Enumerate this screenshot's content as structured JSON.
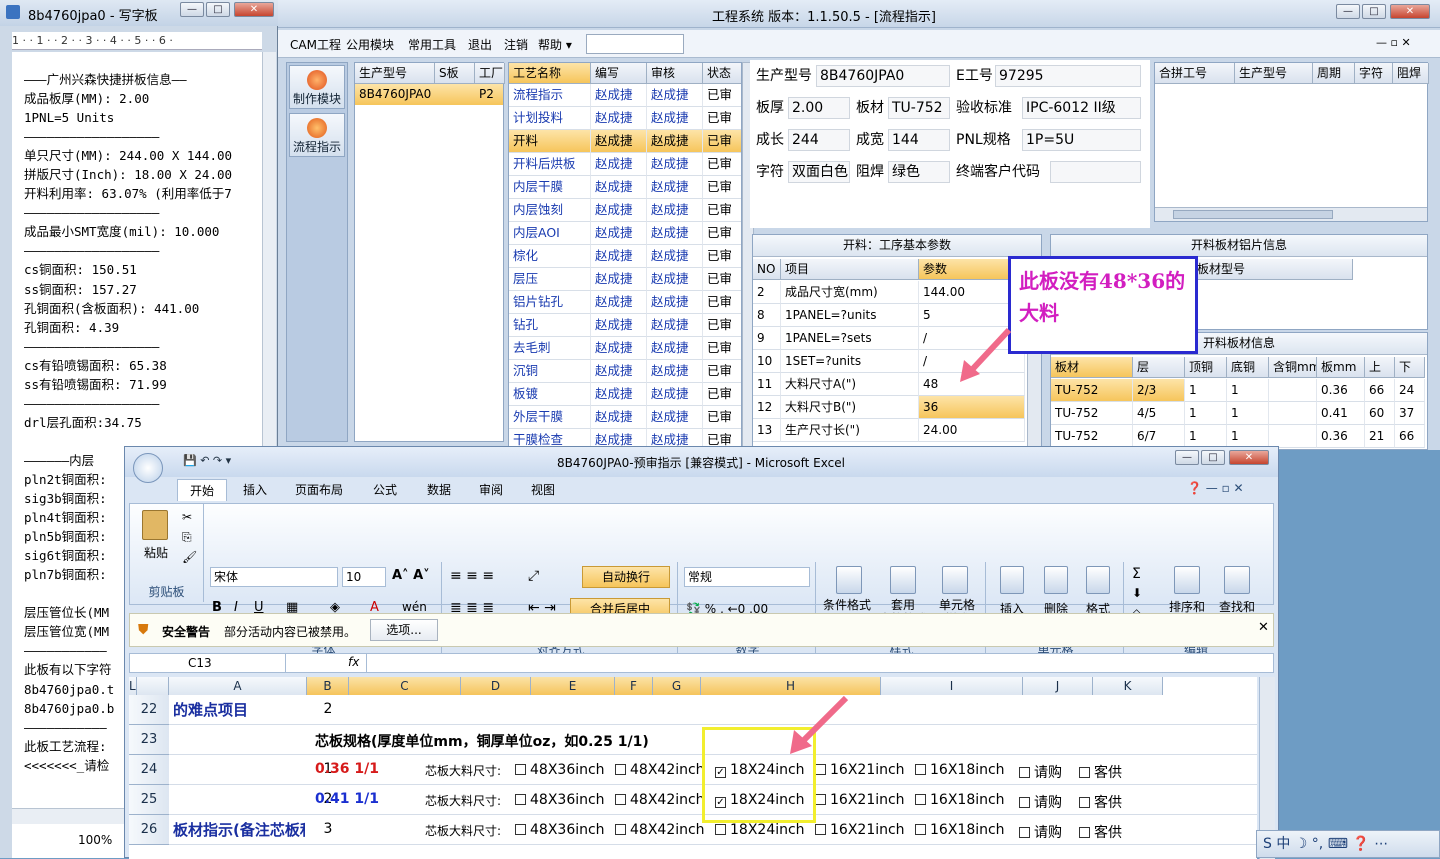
{
  "wordpad": {
    "title": "8b4760jpa0 - 写字板",
    "ruler": "1 · · 1 · · 2 · · 3 · · 4 · · 5 · · 6 ·",
    "lines": [
      "———广州兴森快捷拼板信息——",
      "成品板厚(MM): 2.00",
      "1PNL=5 Units",
      "——————————————————",
      "单只尺寸(MM): 244.00 X 144.00",
      "拼版尺寸(Inch): 18.00 X 24.00",
      "开料利用率: 63.07% (利用率低于7",
      "——————————————————",
      "成品最小SMT宽度(mil): 10.000",
      "——————————————————",
      "cs铜面积: 150.51",
      "ss铜面积: 157.27",
      "孔铜面积(含板面积): 441.00",
      "孔铜面积: 4.39",
      "——————————————————",
      "cs有铅喷锡面积: 65.38",
      "ss有铅喷锡面积: 71.99",
      "——————————————————",
      "drl层孔面积:34.75",
      "",
      "——————内层",
      "pln2t铜面积:",
      "sig3b铜面积:",
      "pln4t铜面积:",
      "pln5b铜面积:",
      "sig6t铜面积:",
      "pln7b铜面积:",
      "",
      "层压管位长(MM",
      "层压管位宽(MM",
      "———————————",
      "此板有以下字符",
      "8b4760jpa0.t",
      "8b4760jpa0.b",
      "———————————",
      "此板工艺流程:",
      "<<<<<<<_请检"
    ],
    "zoom": "100%"
  },
  "eng": {
    "title": "工程系统   版本：1.1.50.5 - [流程指示]",
    "menu": [
      "CAM工程",
      "公用模块",
      "常用工具",
      "退出",
      "注销",
      "帮助 ▾"
    ],
    "side_buttons": [
      "制作模块",
      "流程指示"
    ],
    "model_grid": {
      "headers": [
        "生产型号",
        "S板",
        "工厂"
      ],
      "row": [
        "8B4760JPA0",
        "",
        "P2"
      ]
    },
    "process_grid": {
      "headers": [
        "工艺名称",
        "编写",
        "审核",
        "状态"
      ],
      "rows": [
        [
          "流程指示",
          "赵成捷",
          "赵成捷",
          "已审"
        ],
        [
          "计划投料",
          "赵成捷",
          "赵成捷",
          "已审"
        ],
        [
          "开料",
          "赵成捷",
          "赵成捷",
          "已审"
        ],
        [
          "开料后烘板",
          "赵成捷",
          "赵成捷",
          "已审"
        ],
        [
          "内层干膜",
          "赵成捷",
          "赵成捷",
          "已审"
        ],
        [
          "内层蚀刻",
          "赵成捷",
          "赵成捷",
          "已审"
        ],
        [
          "内层AOI",
          "赵成捷",
          "赵成捷",
          "已审"
        ],
        [
          "棕化",
          "赵成捷",
          "赵成捷",
          "已审"
        ],
        [
          "层压",
          "赵成捷",
          "赵成捷",
          "已审"
        ],
        [
          "铝片钻孔",
          "赵成捷",
          "赵成捷",
          "已审"
        ],
        [
          "钻孔",
          "赵成捷",
          "赵成捷",
          "已审"
        ],
        [
          "去毛刺",
          "赵成捷",
          "赵成捷",
          "已审"
        ],
        [
          "沉铜",
          "赵成捷",
          "赵成捷",
          "已审"
        ],
        [
          "板镀",
          "赵成捷",
          "赵成捷",
          "已审"
        ],
        [
          "外层干膜",
          "赵成捷",
          "赵成捷",
          "已审"
        ],
        [
          "干膜检查",
          "赵成捷",
          "赵成捷",
          "已审"
        ]
      ]
    },
    "info": {
      "model_label": "生产型号",
      "model": "8B4760JPA0",
      "eno_label": "E工号",
      "eno": "97295",
      "thick_label": "板厚",
      "thick": "2.00",
      "mat_label": "板材",
      "mat": "TU-752",
      "std_label": "验收标准",
      "std": "IPC-6012 II级",
      "len_label": "成长",
      "len": "244",
      "wid_label": "成宽",
      "wid": "144",
      "pnl_label": "PNL规格",
      "pnl": "1P=5U",
      "char_label": "字符",
      "char": "双面白色",
      "mask_label": "阻焊",
      "mask": "绿色",
      "cust_label": "终端客户代码",
      "cust": ""
    },
    "combine_headers": [
      "合拼工号",
      "生产型号",
      "周期",
      "字符",
      "阻焊"
    ],
    "params_title": "开料：工序基本参数",
    "params_headers": [
      "NO",
      "项目",
      "参数"
    ],
    "params": [
      [
        "2",
        "成品尺寸宽(mm)",
        "144.00"
      ],
      [
        "8",
        "1PANEL=?units",
        "5"
      ],
      [
        "9",
        "1PANEL=?sets",
        "/"
      ],
      [
        "10",
        "1SET=?units",
        "/"
      ],
      [
        "11",
        "大料尺寸A(\")",
        "48"
      ],
      [
        "12",
        "大料尺寸B(\")",
        "36"
      ],
      [
        "13",
        "生产尺寸长(\")",
        "24.00"
      ]
    ],
    "al_title": "开料板材铝片信息",
    "al_header": "板材型号",
    "mat_title": "开料板材信息",
    "mat_headers": [
      "板材",
      "层",
      "顶铜",
      "底铜",
      "含铜mm",
      "板mm",
      "上",
      "下"
    ],
    "mat_rows": [
      [
        "TU-752",
        "2/3",
        "1",
        "1",
        "",
        "0.36",
        "66",
        "24"
      ],
      [
        "TU-752",
        "4/5",
        "1",
        "1",
        "",
        "0.41",
        "60",
        "37"
      ],
      [
        "TU-752",
        "6/7",
        "1",
        "1",
        "",
        "0.36",
        "21",
        "66"
      ]
    ],
    "annotation": "此板没有48*36的大料"
  },
  "excel": {
    "title": "8B4760JPA0-预审指示  [兼容模式] - Microsoft Excel",
    "tabs": [
      "开始",
      "插入",
      "页面布局",
      "公式",
      "数据",
      "审阅",
      "视图"
    ],
    "font_name": "宋体",
    "font_size": "10",
    "number_format": "常规",
    "groups": [
      "剪贴板",
      "字体",
      "对齐方式",
      "数字",
      "样式",
      "单元格",
      "编辑"
    ],
    "buttons": {
      "paste": "粘贴",
      "wrap": "自动换行",
      "merge": "合并后居中",
      "cond": "条件格式",
      "table": "套用\n表格格式",
      "cellstyle": "单元格\n样式",
      "insert": "插入",
      "delete": "删除",
      "format": "格式",
      "sort": "排序和\n筛选",
      "find": "查找和\n选择"
    },
    "security_label": "安全警告",
    "security_text": "部分活动内容已被禁用。",
    "security_btn": "选项...",
    "cell_ref": "C13",
    "formula_fx": "fx",
    "columns": [
      "A",
      "B",
      "C",
      "D",
      "E",
      "F",
      "G",
      "H",
      "I",
      "J",
      "K",
      "L"
    ],
    "rows": [
      {
        "n": "22",
        "a": "的难点项目",
        "b": "2"
      },
      {
        "n": "23",
        "c": "芯板规格(厚度单位mm，铜厚单位oz，如0.25 1/1)"
      },
      {
        "n": "24",
        "b": "1",
        "c": "0.36 1/1",
        "label": "芯板大料尺寸:",
        "checks": [
          "48X36inch",
          "48X42inch",
          "18X24inch",
          "16X21inch",
          "16X18inch",
          "请购",
          "客供"
        ],
        "checked": [
          false,
          false,
          true,
          false,
          false,
          false,
          false
        ]
      },
      {
        "n": "25",
        "b": "2",
        "c": "0.41 1/1",
        "label": "芯板大料尺寸:",
        "checks": [
          "48X36inch",
          "48X42inch",
          "18X24inch",
          "16X21inch",
          "16X18inch",
          "请购",
          "客供"
        ],
        "checked": [
          false,
          false,
          true,
          false,
          false,
          false,
          false
        ]
      },
      {
        "n": "26",
        "a": "板材指示(备注芯板和半片",
        "b": "3",
        "label": "芯板大料尺寸:",
        "checks": [
          "48X36inch",
          "48X42inch",
          "18X24inch",
          "16X21inch",
          "16X18inch",
          "请购",
          "客供"
        ],
        "checked": [
          false,
          false,
          false,
          false,
          false,
          false,
          false
        ]
      }
    ],
    "zoom": "100%"
  },
  "colors": {
    "accent": "#f5c45c",
    "annotation": "#d21ec0",
    "arrow": "#f06a8a"
  }
}
